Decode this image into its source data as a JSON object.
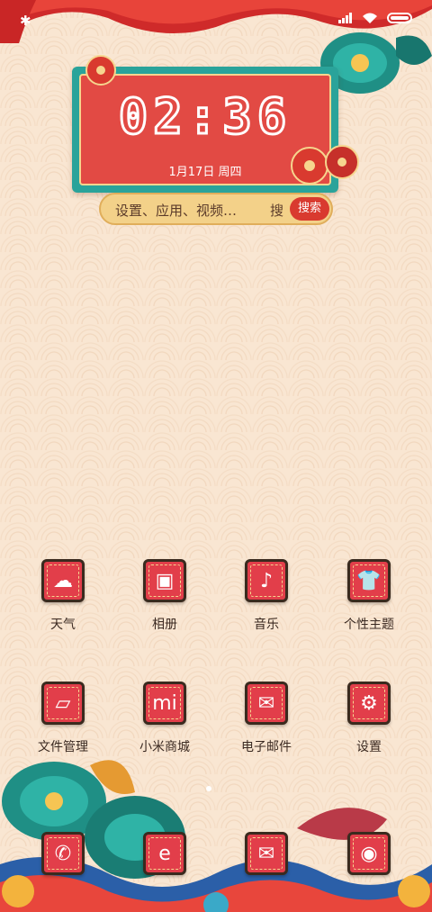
{
  "status_bar": {
    "bluetooth_icon": "bluetooth-icon",
    "signal_icon": "signal-icon",
    "wifi_icon": "wifi-icon",
    "battery_icon": "battery-icon"
  },
  "clock": {
    "time": "02:36",
    "date": "1月17日 周四"
  },
  "search": {
    "placeholder": "设置、应用、视频…",
    "char": "搜",
    "button_label": "搜索"
  },
  "apps": [
    {
      "label": "天气",
      "icon": "cloud-icon",
      "glyph": "☁"
    },
    {
      "label": "相册",
      "icon": "gallery-icon",
      "glyph": "▣"
    },
    {
      "label": "音乐",
      "icon": "music-icon",
      "glyph": "♪"
    },
    {
      "label": "个性主题",
      "icon": "tshirt-icon",
      "glyph": "👕"
    },
    {
      "label": "文件管理",
      "icon": "folder-icon",
      "glyph": "▱"
    },
    {
      "label": "小米商城",
      "icon": "mi-icon",
      "glyph": "mi"
    },
    {
      "label": "电子邮件",
      "icon": "mail-icon",
      "glyph": "✉"
    },
    {
      "label": "设置",
      "icon": "gear-icon",
      "glyph": "⚙"
    }
  ],
  "dock": [
    {
      "icon": "phone-icon",
      "glyph": "✆"
    },
    {
      "icon": "browser-icon",
      "glyph": "e"
    },
    {
      "icon": "message-icon",
      "glyph": "✉"
    },
    {
      "icon": "camera-icon",
      "glyph": "◉"
    }
  ],
  "colors": {
    "accent_red": "#e24a44",
    "teal": "#2aa39a",
    "gold": "#f3d189"
  }
}
